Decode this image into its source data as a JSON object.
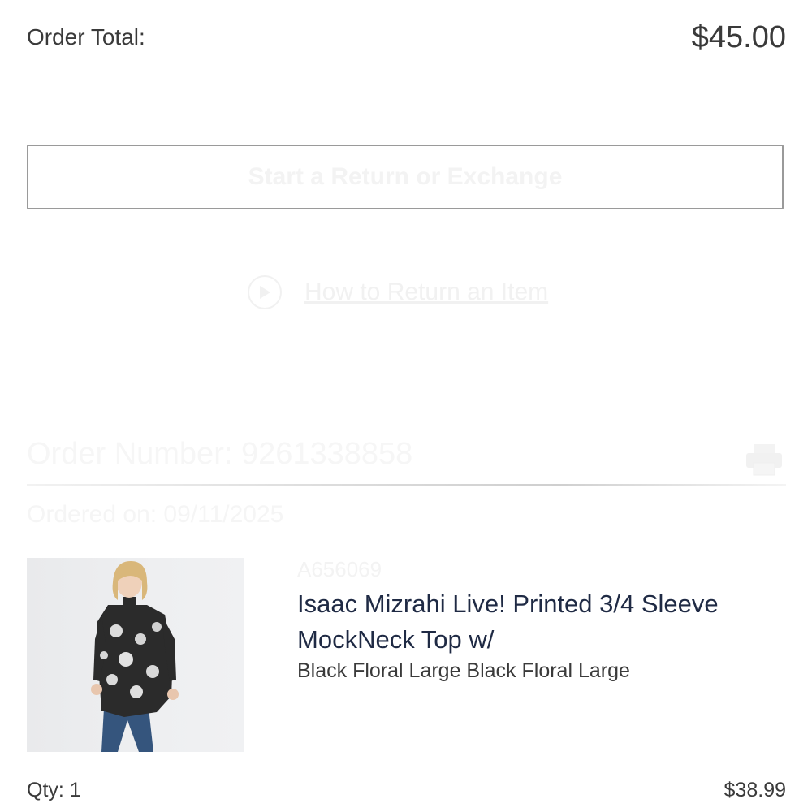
{
  "summary": {
    "order_total_label": "Order Total:",
    "order_total_value": "$45.00"
  },
  "actions": {
    "return_button_label": "Start a Return or Exchange",
    "howto_link_label": "How to Return an Item",
    "howto_icon": "play-circle-icon"
  },
  "order": {
    "number_label": "Order Number: 9261338858",
    "ordered_on": "Ordered on: 09/11/2025",
    "print_icon": "printer-icon"
  },
  "item": {
    "sku": "A656069",
    "name": "Isaac Mizrahi Live! Printed 3/4 Sleeve MockNeck Top w/",
    "variant": "Black Floral Large Black Floral Large",
    "qty": "Qty: 1",
    "price": "$38.99"
  }
}
